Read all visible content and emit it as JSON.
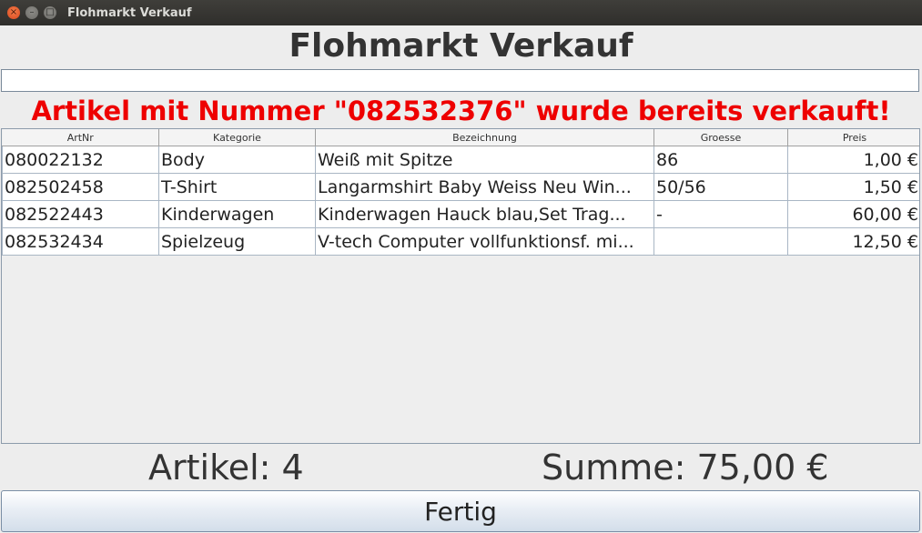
{
  "window": {
    "title": "Flohmarkt Verkauf",
    "close_glyph": "×",
    "min_glyph": "–",
    "max_glyph": "□"
  },
  "header": {
    "title": "Flohmarkt Verkauf"
  },
  "scan_input": {
    "value": "",
    "placeholder": ""
  },
  "message": {
    "text": "Artikel mit Nummer \"082532376\" wurde bereits verkauft!",
    "color": "#ee0000"
  },
  "table": {
    "columns": [
      "ArtNr",
      "Kategorie",
      "Bezeichnung",
      "Groesse",
      "Preis"
    ],
    "rows": [
      [
        "080022132",
        "Body",
        "Weiß mit Spitze",
        "86",
        "1,00 €"
      ],
      [
        "082502458",
        "T-Shirt",
        "Langarmshirt Baby Weiss Neu Win...",
        "50/56",
        "1,50 €"
      ],
      [
        "082522443",
        "Kinderwagen",
        "Kinderwagen Hauck blau,Set Trag...",
        "-",
        "60,00 €"
      ],
      [
        "082532434",
        "Spielzeug",
        "V-tech Computer vollfunktionsf. mi...",
        "",
        "12,50 €"
      ]
    ]
  },
  "footer": {
    "count_label": "Artikel: 4",
    "sum_label": "Summe: 75,00 €",
    "done_button": "Fertig"
  },
  "colors": {
    "titlebar": "#3c3b37",
    "error": "#ee0000",
    "button_gradient_end": "#d3deea"
  }
}
